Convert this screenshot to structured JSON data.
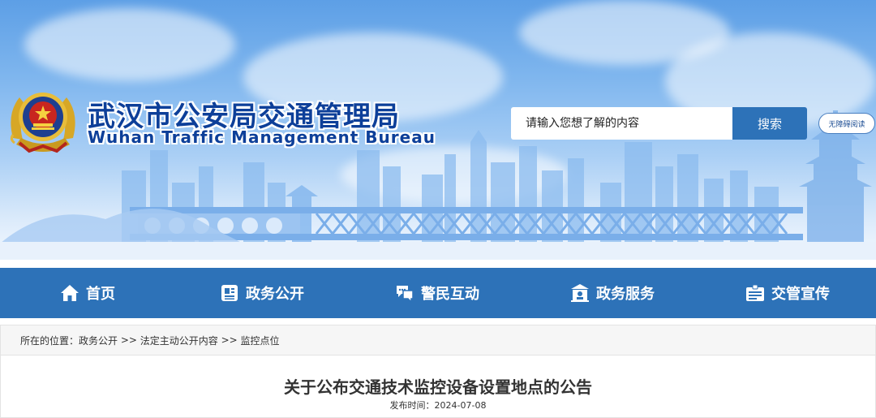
{
  "header": {
    "title_cn": "武汉市公安局交通管理局",
    "title_en": "Wuhan Traffic Management Bureau",
    "search": {
      "placeholder": "请输入您想了解的内容",
      "button_label": "搜索"
    },
    "accessibility_label": "无障碍阅读"
  },
  "nav": {
    "items": [
      {
        "label": "首页",
        "icon": "home-icon"
      },
      {
        "label": "政务公开",
        "icon": "document-icon"
      },
      {
        "label": "警民互动",
        "icon": "chat-icon"
      },
      {
        "label": "政务服务",
        "icon": "service-building-icon"
      },
      {
        "label": "交管宣传",
        "icon": "id-card-icon"
      }
    ]
  },
  "breadcrumb": {
    "label": "所在的位置：",
    "items": [
      "政务公开",
      "法定主动公开内容",
      "监控点位"
    ],
    "separator": " >> "
  },
  "article": {
    "title": "关于公布交通技术监控设备设置地点的公告",
    "date_label": "发布时间：",
    "date": "2024-07-08"
  },
  "colors": {
    "brand_blue": "#2d72b8",
    "title_blue": "#0d3f99"
  }
}
